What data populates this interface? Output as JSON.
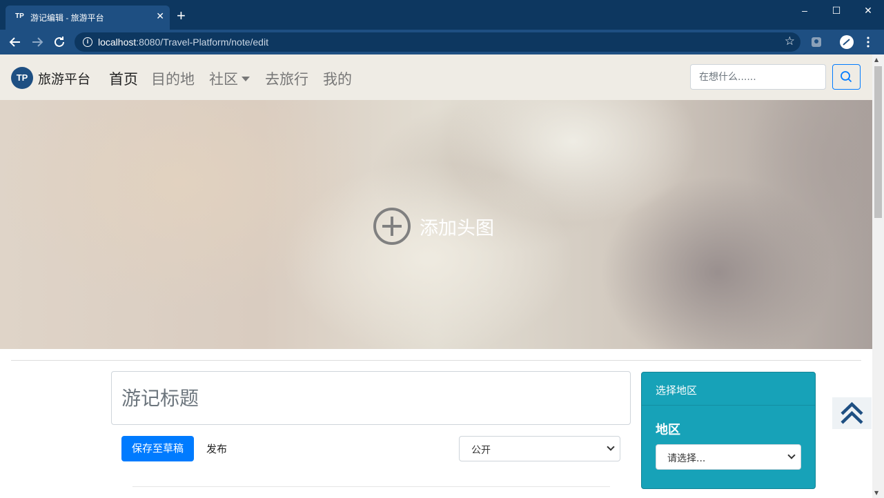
{
  "browser": {
    "tab_title": "游记编辑 - 旅游平台",
    "tab_favicon": "TP",
    "close_tab": "✕",
    "new_tab": "+",
    "url_host": "localhost",
    "url_rest": ":8080/Travel-Platform/note/edit",
    "window_controls": {
      "minimize": "–",
      "maximize": "☐",
      "close": "✕"
    }
  },
  "navbar": {
    "logo_text": "TP",
    "brand": "旅游平台",
    "links": [
      {
        "label": "首页",
        "active": true
      },
      {
        "label": "目的地",
        "active": false
      },
      {
        "label": "社区",
        "active": false,
        "dropdown": true
      },
      {
        "label": "去旅行",
        "active": false
      },
      {
        "label": "我的",
        "active": false
      }
    ],
    "search_placeholder": "在想什么......"
  },
  "hero": {
    "add_cover_label": "添加头图"
  },
  "editor": {
    "title_placeholder": "游记标题",
    "save_draft_label": "保存至草稿",
    "publish_label": "发布",
    "visibility_value": "公开"
  },
  "region_card": {
    "header": "选择地区",
    "label": "地区",
    "select_value": "请选择..."
  },
  "colors": {
    "chrome_dark": "#0d3760",
    "chrome": "#1e4f82",
    "primary": "#007bff",
    "info": "#17a2b8",
    "navbar_bg": "#efece5"
  }
}
